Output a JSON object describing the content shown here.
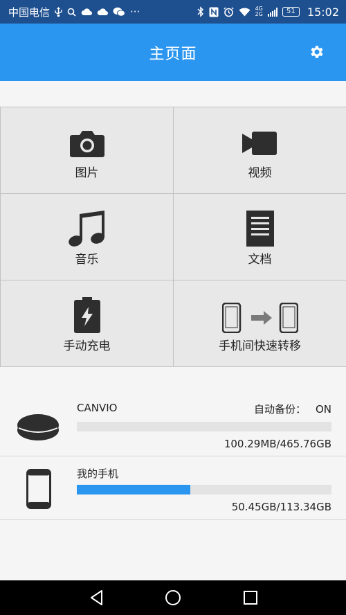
{
  "status_bar": {
    "carrier": "中国电信",
    "signal_top": "4G",
    "signal_bottom": "2G",
    "battery": "51",
    "time": "15:02",
    "more": "···"
  },
  "app_bar": {
    "title": "主页面",
    "settings_icon": "gear-icon"
  },
  "tiles": [
    {
      "label": "图片",
      "icon": "camera-icon"
    },
    {
      "label": "视频",
      "icon": "video-camera-icon"
    },
    {
      "label": "音乐",
      "icon": "music-note-icon"
    },
    {
      "label": "文档",
      "icon": "document-icon"
    },
    {
      "label": "手动充电",
      "icon": "battery-charging-icon"
    },
    {
      "label": "手机间快速转移",
      "icon": "phone-transfer-icon"
    }
  ],
  "storage": [
    {
      "name": "CANVIO",
      "backup_label": "自动备份：",
      "backup_value": "ON",
      "usage": "100.29MB/465.76GB",
      "used_fraction": 0.0002,
      "icon": "external-drive-icon"
    },
    {
      "name": "我的手机",
      "usage": "50.45GB/113.34GB",
      "used_fraction": 0.445,
      "icon": "phone-icon"
    }
  ],
  "colors": {
    "status_bar": "#1e4f8f",
    "app_bar": "#2b96f0",
    "progress": "#2b96f0",
    "tile_bg": "#e8e8e8"
  },
  "nav": [
    "back-icon",
    "home-icon",
    "recents-icon"
  ]
}
